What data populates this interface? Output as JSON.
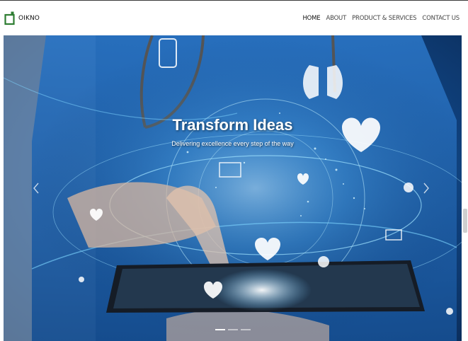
{
  "brand": {
    "name": "OIKNO",
    "logo_icon": "oikno-logo-icon",
    "accent": "#2e7d32"
  },
  "nav": {
    "items": [
      {
        "label": "HOME",
        "active": true
      },
      {
        "label": "ABOUT",
        "active": false
      },
      {
        "label": "PRODUCT & SERVICES",
        "active": false
      },
      {
        "label": "CONTACT US",
        "active": false
      }
    ]
  },
  "hero": {
    "title": "Transform Ideas",
    "subtitle": "Delivering excellence every step of the way",
    "prev_icon": "chevron-left-icon",
    "next_icon": "chevron-right-icon",
    "slides_count": 3,
    "active_slide": 1
  }
}
